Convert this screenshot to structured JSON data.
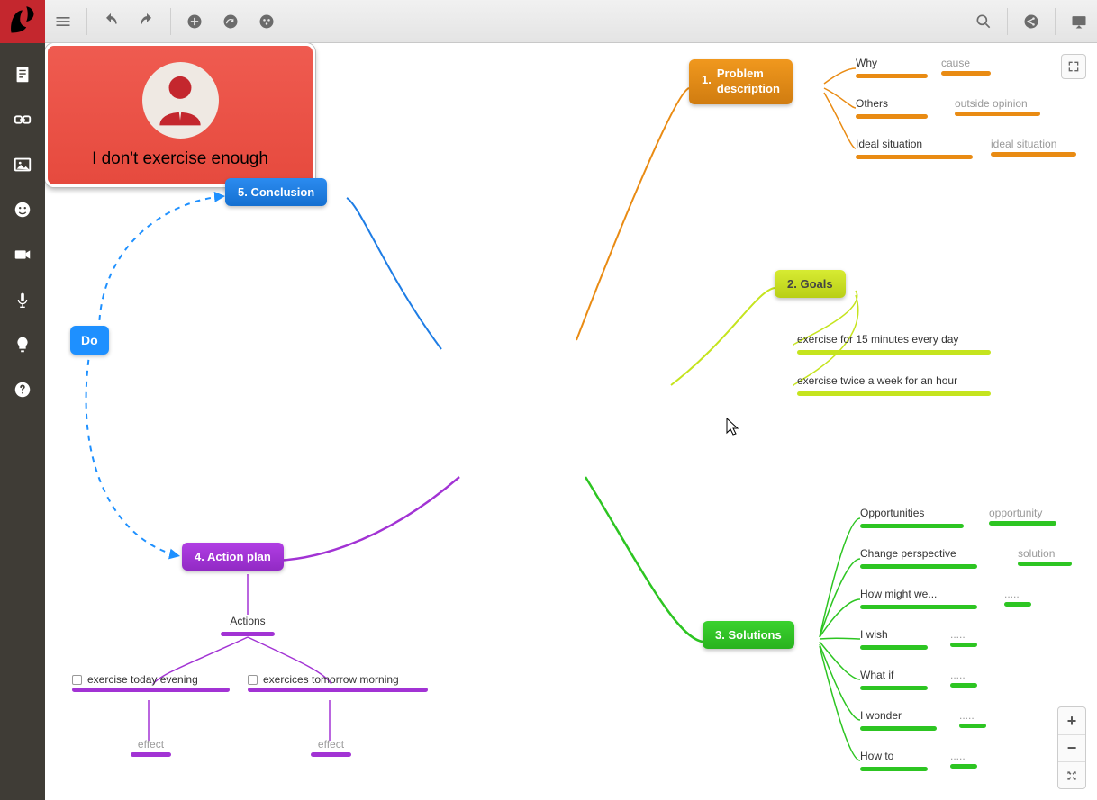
{
  "center": {
    "title": "I don't exercise enough"
  },
  "branches": {
    "problem": {
      "num": "1.",
      "label": "Problem\ndescription",
      "color": "#e98b13",
      "children": [
        {
          "label": "Why",
          "sub": "cause"
        },
        {
          "label": "Others",
          "sub": "outside opinion"
        },
        {
          "label": "Ideal situation",
          "sub": "ideal situation"
        }
      ]
    },
    "goals": {
      "num": "2.",
      "label": "Goals",
      "color": "#c5e41e",
      "children": [
        {
          "label": "exercise for 15 minutes every day"
        },
        {
          "label": "exercise twice a week for an hour"
        }
      ]
    },
    "solutions": {
      "num": "3.",
      "label": "Solutions",
      "color": "#2dc522",
      "children": [
        {
          "label": "Opportunities",
          "sub": "opportunity"
        },
        {
          "label": "Change perspective",
          "sub": "solution"
        },
        {
          "label": "How might we...",
          "sub": "....."
        },
        {
          "label": "I wish",
          "sub": "....."
        },
        {
          "label": "What if",
          "sub": "....."
        },
        {
          "label": "I wonder",
          "sub": "....."
        },
        {
          "label": "How to",
          "sub": "....."
        }
      ]
    },
    "action": {
      "num": "4.",
      "label": "Action plan",
      "color": "#a233d4",
      "actions_label": "Actions",
      "tasks": [
        {
          "label": "exercise today evening",
          "effect": "effect"
        },
        {
          "label": "exercices tomorrow morning",
          "effect": "effect"
        }
      ]
    },
    "conclusion": {
      "num": "5.",
      "label": "Conclusion",
      "color": "#1a7ae0"
    }
  },
  "do_node": {
    "label": "Do"
  }
}
